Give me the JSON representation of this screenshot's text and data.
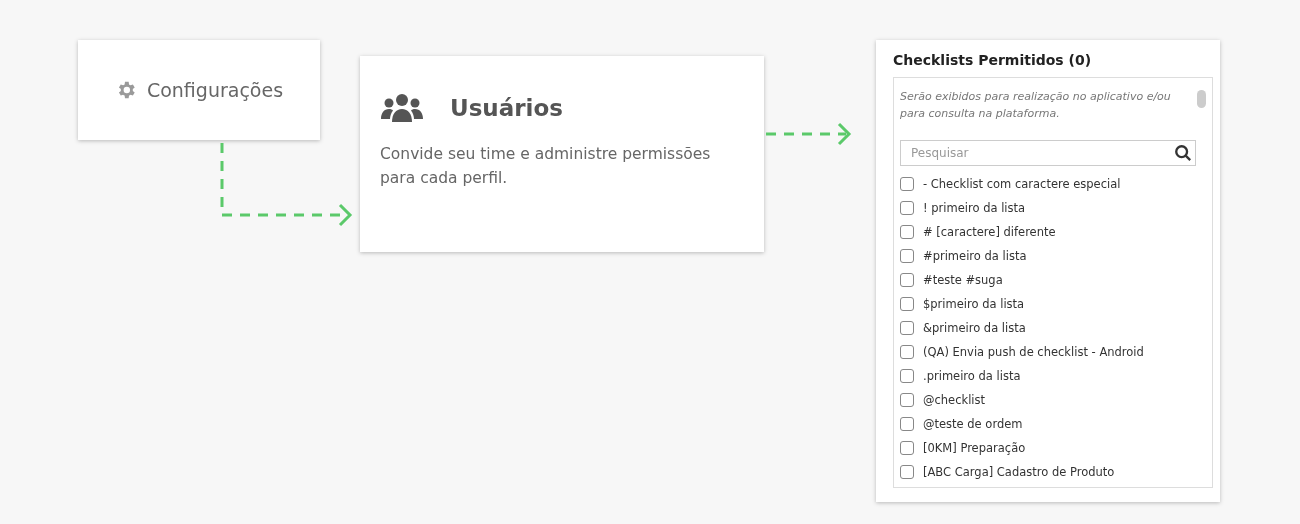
{
  "settings_card": {
    "label": "Configurações"
  },
  "users_card": {
    "title": "Usuários",
    "description": "Convide seu time e administre permissões para cada perfil."
  },
  "checklists_panel": {
    "title": "Checklists Permitidos (0)",
    "hint": "Serão exibidos para realização no aplicativo e/ou para consulta na plataforma.",
    "search": {
      "placeholder": "Pesquisar"
    },
    "items": [
      {
        "label": "- Checklist com caractere especial",
        "checked": false
      },
      {
        "label": "! primeiro da lista",
        "checked": false
      },
      {
        "label": "# [caractere] diferente",
        "checked": false
      },
      {
        "label": "#primeiro da lista",
        "checked": false
      },
      {
        "label": "#teste #suga",
        "checked": false
      },
      {
        "label": "$primeiro da lista",
        "checked": false
      },
      {
        "label": "&primeiro da lista",
        "checked": false
      },
      {
        "label": "(QA) Envia push de checklist - Android",
        "checked": false
      },
      {
        "label": ".primeiro da lista",
        "checked": false
      },
      {
        "label": "@checklist",
        "checked": false
      },
      {
        "label": "@teste de ordem",
        "checked": false
      },
      {
        "label": "[0KM] Preparação",
        "checked": false
      },
      {
        "label": "[ABC Carga] Cadastro de Produto",
        "checked": false
      }
    ]
  }
}
